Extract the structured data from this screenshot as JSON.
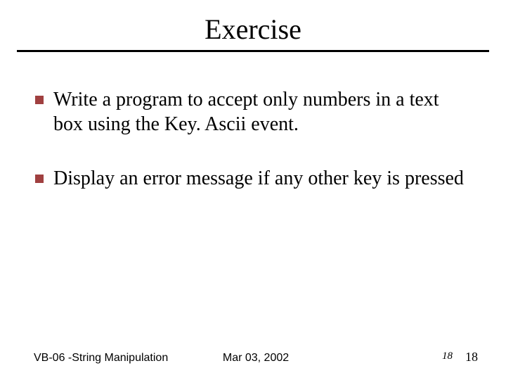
{
  "slide": {
    "title": "Exercise",
    "bullets": [
      {
        "text": "Write a program to accept only numbers in a text box using the Key. Ascii event."
      },
      {
        "text": "Display an error message if any other key is pressed"
      }
    ]
  },
  "footer": {
    "left": "VB-06 -String Manipulation",
    "center": "Mar 03, 2002",
    "page_main": "18",
    "page_overlay": "18"
  }
}
